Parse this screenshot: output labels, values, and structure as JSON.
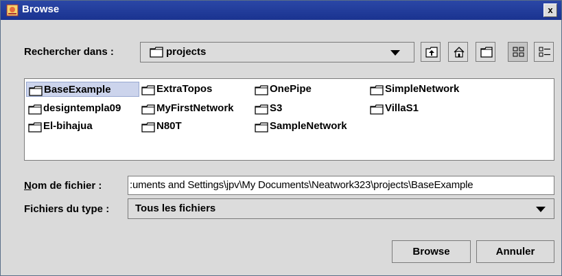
{
  "window": {
    "title": "Browse",
    "close_label": "x"
  },
  "lookin": {
    "label": "Rechercher dans :",
    "value": "projects"
  },
  "toolbar": {
    "icons": [
      "up-folder-icon",
      "home-icon",
      "new-folder-icon",
      "list-view-icon",
      "details-view-icon"
    ]
  },
  "files": {
    "items": [
      {
        "name": "BaseExample",
        "selected": true
      },
      {
        "name": "designtempla09"
      },
      {
        "name": "El-bihajua"
      },
      {
        "name": "ExtraTopos"
      },
      {
        "name": "MyFirstNetwork"
      },
      {
        "name": "N80T"
      },
      {
        "name": "OnePipe"
      },
      {
        "name": "S3"
      },
      {
        "name": "SampleNetwork"
      },
      {
        "name": "SimpleNetwork"
      },
      {
        "name": "VillaS1"
      }
    ]
  },
  "filename": {
    "label_first": "N",
    "label_rest": "om de fichier :",
    "value": ":uments and Settings\\jpv\\My Documents\\Neatwork323\\projects\\BaseExample"
  },
  "filetype": {
    "label": "Fichiers du type :",
    "value": "Tous les fichiers"
  },
  "buttons": {
    "browse": "Browse",
    "cancel": "Annuler"
  },
  "colors": {
    "titlebar": "#1f3b9a",
    "selection": "#ccd4ec",
    "dialog": "#dadada"
  }
}
